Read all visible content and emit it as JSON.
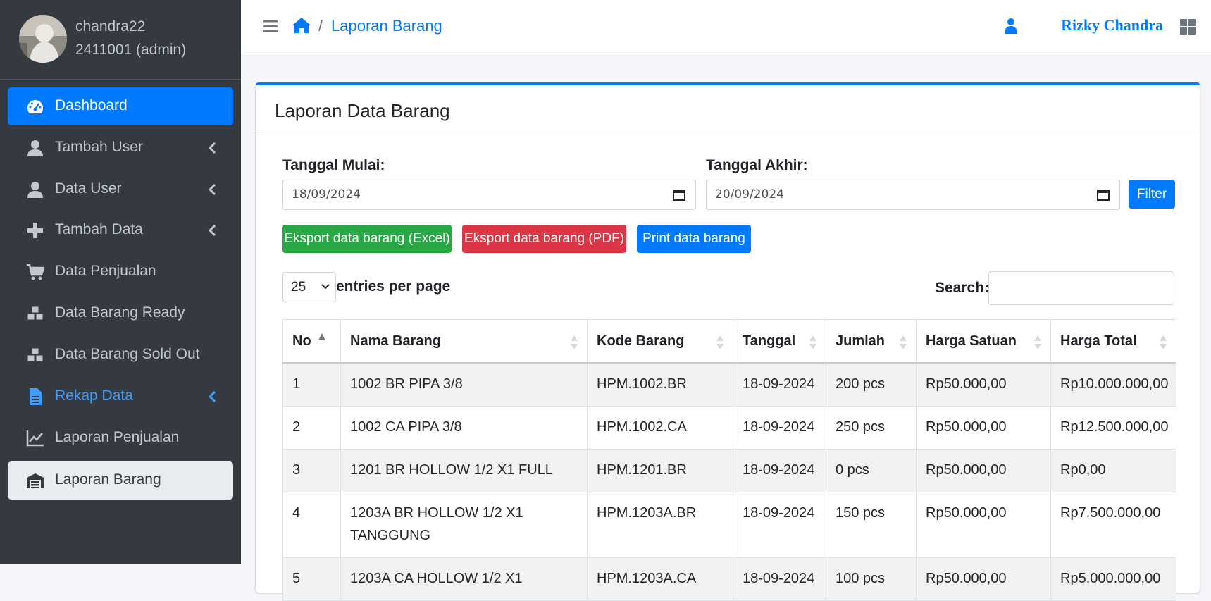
{
  "user": {
    "username": "chandra22",
    "id_role": "2411001 (admin)"
  },
  "sidebar": {
    "items": [
      {
        "label": "Dashboard",
        "icon": "tachometer-icon",
        "chevron": false
      },
      {
        "label": "Tambah User",
        "icon": "user-icon",
        "chevron": true
      },
      {
        "label": "Data User",
        "icon": "user-icon",
        "chevron": true
      },
      {
        "label": "Tambah Data",
        "icon": "plus-icon",
        "chevron": true
      },
      {
        "label": "Data Penjualan",
        "icon": "cart-icon",
        "chevron": false
      },
      {
        "label": "Data Barang Ready",
        "icon": "cubes-icon",
        "chevron": false
      },
      {
        "label": "Data Barang Sold Out",
        "icon": "cubes-icon",
        "chevron": false
      },
      {
        "label": "Rekap Data",
        "icon": "file-icon",
        "chevron": true
      },
      {
        "label": "Laporan Penjualan",
        "icon": "chart-line-icon",
        "chevron": false
      },
      {
        "label": "Laporan Barang",
        "icon": "warehouse-icon",
        "chevron": false
      }
    ]
  },
  "topbar": {
    "breadcrumb_sep": "/",
    "breadcrumb_current": "Laporan Barang",
    "user_name": "Rizky Chandra"
  },
  "card": {
    "title": "Laporan Data Barang"
  },
  "filter": {
    "start_label": "Tanggal Mulai:",
    "start_value": "18/09/2024",
    "end_label": "Tanggal Akhir:",
    "end_value": "20/09/2024",
    "button": "Filter"
  },
  "actions": {
    "excel": "Eksport data barang (Excel)",
    "pdf": "Eksport data barang (PDF)",
    "print": "Print data barang"
  },
  "datatable": {
    "entries_value": "25",
    "entries_label": "entries per page",
    "search_label": "Search:"
  },
  "table": {
    "headers": [
      "No",
      "Nama Barang",
      "Kode Barang",
      "Tanggal",
      "Jumlah",
      "Harga Satuan",
      "Harga Total"
    ],
    "rows": [
      [
        "1",
        "1002 BR PIPA 3/8",
        "HPM.1002.BR",
        "18-09-2024",
        "200 pcs",
        "Rp50.000,00",
        "Rp10.000.000,00"
      ],
      [
        "2",
        "1002 CA PIPA 3/8",
        "HPM.1002.CA",
        "18-09-2024",
        "250 pcs",
        "Rp50.000,00",
        "Rp12.500.000,00"
      ],
      [
        "3",
        "1201 BR HOLLOW 1/2 X1 FULL",
        "HPM.1201.BR",
        "18-09-2024",
        "0 pcs",
        "Rp50.000,00",
        "Rp0,00"
      ],
      [
        "4",
        "1203A BR HOLLOW 1/2 X1 TANGGUNG",
        "HPM.1203A.BR",
        "18-09-2024",
        "150 pcs",
        "Rp50.000,00",
        "Rp7.500.000,00"
      ],
      [
        "5",
        "1203A CA HOLLOW 1/2 X1",
        "HPM.1203A.CA",
        "18-09-2024",
        "100 pcs",
        "Rp50.000,00",
        "Rp5.000.000,00"
      ]
    ]
  },
  "colors": {
    "primary": "#007bff",
    "sidebar_bg": "#343a40",
    "success": "#28a745",
    "danger": "#dc3545"
  }
}
